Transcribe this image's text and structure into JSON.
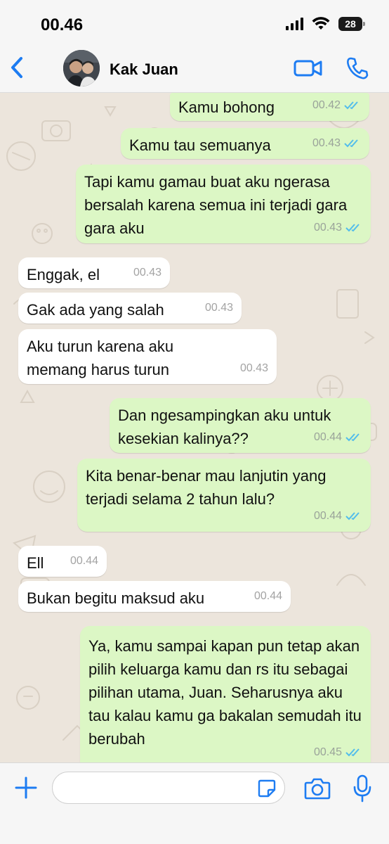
{
  "status": {
    "time": "00.46",
    "battery": "28"
  },
  "header": {
    "contact_name": "Kak Juan",
    "icons": [
      "chevron-left-icon",
      "avatar",
      "video-icon",
      "phone-icon"
    ]
  },
  "colors": {
    "accent": "#1d7cf2",
    "outgoing_bubble": "#dcf7c5",
    "incoming_bubble": "#ffffff",
    "chat_background": "#ece5dc",
    "read_ticks": "#53bdeb"
  },
  "messages": [
    {
      "dir": "out",
      "text": "Kamu bohong",
      "time": "00.42",
      "read": true
    },
    {
      "dir": "out",
      "text": "Kamu tau semuanya",
      "time": "00.43",
      "read": true
    },
    {
      "dir": "out",
      "text": "Tapi kamu gamau buat aku ngerasa bersalah karena semua ini terjadi gara gara aku",
      "time": "00.43",
      "read": true
    },
    {
      "dir": "in",
      "text": "Enggak, el",
      "time": "00.43"
    },
    {
      "dir": "in",
      "text": "Gak ada yang salah",
      "time": "00.43"
    },
    {
      "dir": "in",
      "text": "Aku turun karena aku memang harus turun",
      "time": "00.43"
    },
    {
      "dir": "out",
      "text": "Dan ngesampingkan aku untuk kesekian kalinya??",
      "time": "00.44",
      "read": true
    },
    {
      "dir": "out",
      "text": "Kita benar-benar mau lanjutin yang terjadi selama 2 tahun lalu?",
      "time": "00.44",
      "read": true
    },
    {
      "dir": "in",
      "text": "Ell",
      "time": "00.44"
    },
    {
      "dir": "in",
      "text": "Bukan begitu maksud aku",
      "time": "00.44"
    },
    {
      "dir": "out",
      "text": "Ya, kamu sampai kapan pun tetap akan pilih keluarga kamu dan rs itu sebagai pilihan utama, Juan. Seharusnya aku tau kalau kamu ga bakalan semudah itu berubah",
      "time": "00.45",
      "read": true
    }
  ],
  "composer": {
    "input_value": "",
    "icons": [
      "plus-icon",
      "sticker-icon",
      "camera-icon",
      "microphone-icon"
    ]
  }
}
